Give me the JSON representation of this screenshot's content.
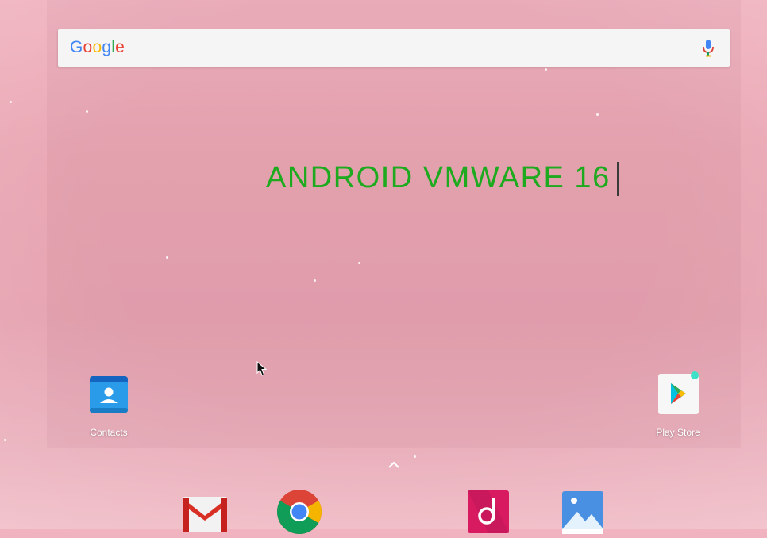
{
  "search": {
    "logo_text": "Google",
    "logo_colors": [
      "#4285F4",
      "#EA4335",
      "#FBBC05",
      "#4285F4",
      "#34A853",
      "#EA4335"
    ],
    "mic_icon": "mic-icon"
  },
  "overlay": {
    "title": "ANDROID VMWARE 16",
    "color": "#1eaa1e"
  },
  "home": {
    "contacts_label": "Contacts",
    "play_store_label": "Play Store"
  },
  "dock": {
    "apps": [
      "gmail-icon",
      "chrome-icon",
      "music-icon",
      "photos-icon"
    ]
  },
  "icons": [
    "contacts-icon",
    "play-store-icon",
    "app-drawer-chevron-icon",
    "mouse-cursor-icon"
  ]
}
